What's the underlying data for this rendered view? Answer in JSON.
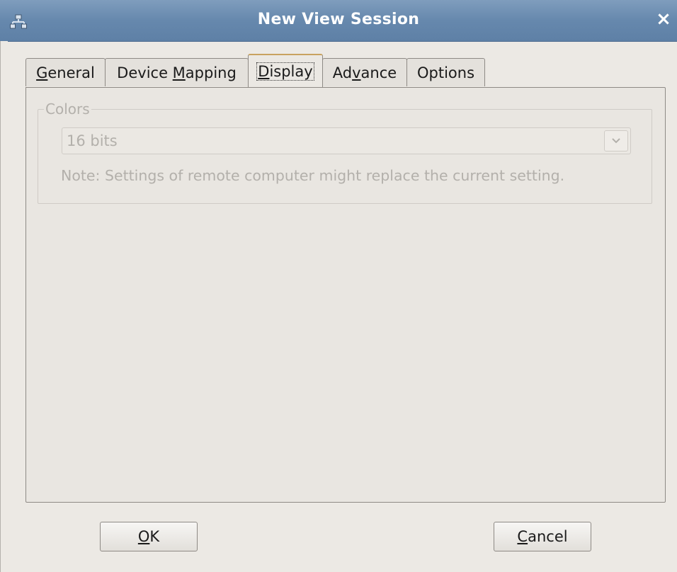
{
  "window": {
    "title": "New View Session",
    "close_glyph": "×",
    "icon": "network-icon"
  },
  "tabs": [
    {
      "pre": "",
      "ul": "G",
      "post": "eneral",
      "active": false
    },
    {
      "pre": "Device ",
      "ul": "M",
      "post": "apping",
      "active": false
    },
    {
      "pre": "",
      "ul": "D",
      "post": "isplay",
      "active": true
    },
    {
      "pre": "Ad",
      "ul": "v",
      "post": "ance",
      "active": false
    },
    {
      "pre": "Options",
      "ul": "",
      "post": "",
      "active": false
    }
  ],
  "display": {
    "group_label": "Colors",
    "color_depth": {
      "selected": "16 bits",
      "enabled": false
    },
    "note": "Note: Settings of remote computer might replace the current setting."
  },
  "buttons": {
    "ok": {
      "ul": "O",
      "post": "K"
    },
    "cancel": {
      "ul": "C",
      "post": "ancel"
    }
  }
}
